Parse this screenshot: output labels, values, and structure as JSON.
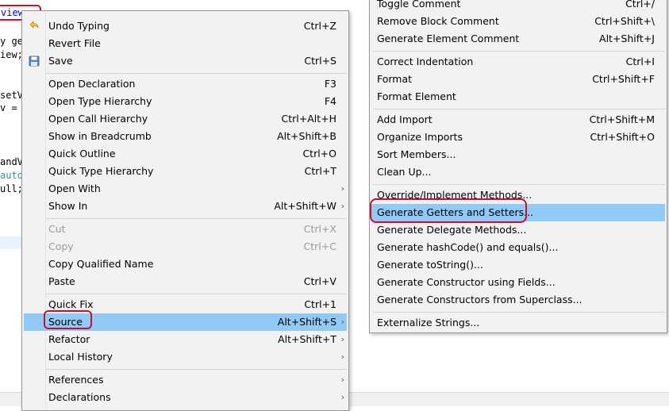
{
  "editor": {
    "lines": [
      {
        "text": "view;",
        "class": ""
      },
      {
        "text": "y ge",
        "class": ""
      },
      {
        "text": "iew;",
        "class": ""
      },
      {
        "text": "setV",
        "class": ""
      },
      {
        "text": "v =",
        "class": ""
      },
      {
        "text": "andV",
        "class": ""
      },
      {
        "text": "auto",
        "class": "grey"
      },
      {
        "text": "ull;",
        "class": ""
      }
    ]
  },
  "main_menu": {
    "items": [
      {
        "label": "Undo Typing",
        "accel": "Ctrl+Z",
        "icon": "undo-icon"
      },
      {
        "label": "Revert File",
        "accel": ""
      },
      {
        "label": "Save",
        "accel": "Ctrl+S",
        "icon": "save-icon"
      },
      {
        "label": "Open Declaration",
        "accel": "F3"
      },
      {
        "label": "Open Type Hierarchy",
        "accel": "F4"
      },
      {
        "label": "Open Call Hierarchy",
        "accel": "Ctrl+Alt+H"
      },
      {
        "label": "Show in Breadcrumb",
        "accel": "Alt+Shift+B"
      },
      {
        "label": "Quick Outline",
        "accel": "Ctrl+O"
      },
      {
        "label": "Quick Type Hierarchy",
        "accel": "Ctrl+T"
      },
      {
        "label": "Open With",
        "accel": "",
        "submenu": true
      },
      {
        "label": "Show In",
        "accel": "Alt+Shift+W",
        "submenu": true
      },
      {
        "label": "Cut",
        "accel": "Ctrl+X",
        "disabled": true
      },
      {
        "label": "Copy",
        "accel": "Ctrl+C",
        "disabled": true
      },
      {
        "label": "Copy Qualified Name",
        "accel": ""
      },
      {
        "label": "Paste",
        "accel": "Ctrl+V"
      },
      {
        "label": "Quick Fix",
        "accel": "Ctrl+1"
      },
      {
        "label": "Source",
        "accel": "Alt+Shift+S",
        "submenu": true,
        "selected": true
      },
      {
        "label": "Refactor",
        "accel": "Alt+Shift+T",
        "submenu": true
      },
      {
        "label": "Local History",
        "accel": "",
        "submenu": true
      },
      {
        "label": "References",
        "accel": "",
        "submenu": true
      },
      {
        "label": "Declarations",
        "accel": "",
        "submenu": true
      }
    ]
  },
  "source_menu": {
    "items": [
      {
        "label": "Toggle Comment",
        "accel": "Ctrl+/"
      },
      {
        "label": "Remove Block Comment",
        "accel": "Ctrl+Shift+\\"
      },
      {
        "label": "Generate Element Comment",
        "accel": "Alt+Shift+J"
      },
      {
        "label": "Correct Indentation",
        "accel": "Ctrl+I"
      },
      {
        "label": "Format",
        "accel": "Ctrl+Shift+F"
      },
      {
        "label": "Format Element",
        "accel": ""
      },
      {
        "label": "Add Import",
        "accel": "Ctrl+Shift+M"
      },
      {
        "label": "Organize Imports",
        "accel": "Ctrl+Shift+O"
      },
      {
        "label": "Sort Members...",
        "accel": ""
      },
      {
        "label": "Clean Up...",
        "accel": ""
      },
      {
        "label": "Override/Implement Methods...",
        "accel": ""
      },
      {
        "label": "Generate Getters and Setters...",
        "accel": "",
        "selected": true
      },
      {
        "label": "Generate Delegate Methods...",
        "accel": ""
      },
      {
        "label": "Generate hashCode() and equals()...",
        "accel": ""
      },
      {
        "label": "Generate toString()...",
        "accel": ""
      },
      {
        "label": "Generate Constructor using Fields...",
        "accel": ""
      },
      {
        "label": "Generate Constructors from Superclass...",
        "accel": ""
      },
      {
        "label": "Externalize Strings...",
        "accel": ""
      }
    ]
  },
  "colors": {
    "selection": "#91c9f7",
    "annotation": "#c8102e",
    "menu_bg": "#f2f2f2"
  }
}
